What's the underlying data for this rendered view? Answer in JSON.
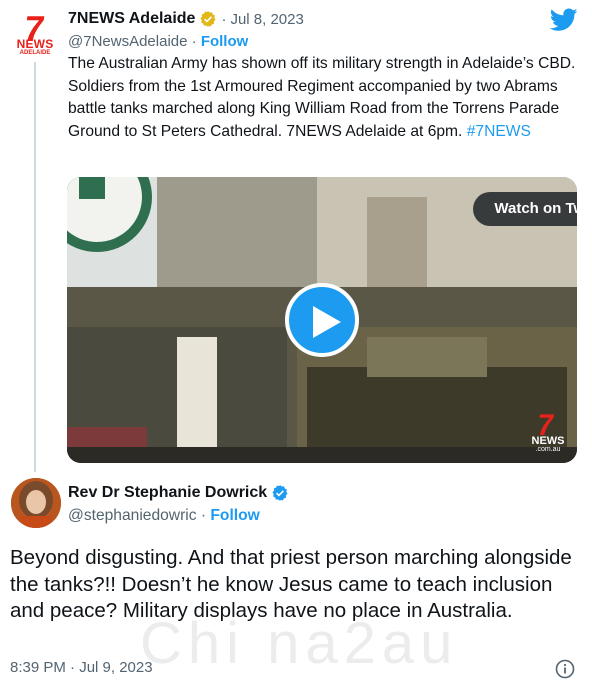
{
  "quoted_tweet": {
    "author_name": "7NEWS Adelaide",
    "date": "Jul 8, 2023",
    "dot": "·",
    "handle": "@7NewsAdelaide",
    "handle_sep": " · ",
    "follow_label": "Follow",
    "text": "The Australian Army has shown off its military strength in Adelaide’s CBD. Soldiers from the 1st Armoured Regiment accompanied by two Abrams battle tanks marched along King William Road from the Torrens Parade Ground to St Peters Cathedral. 7NEWS Adelaide at 6pm. ",
    "hashtag": "#7NEWS",
    "avatar_logo": {
      "seven": "7",
      "news": "NEWS",
      "sub": "ADELAIDE"
    },
    "media": {
      "watch_button_label": "Watch on Twitter",
      "play_icon": "play-icon",
      "logo": {
        "seven": "7",
        "news": "NEWS",
        "domain": ".com.au"
      }
    }
  },
  "main_tweet": {
    "author_name": "Rev Dr Stephanie Dowrick",
    "handle": "@stephaniedowric",
    "handle_sep": " · ",
    "follow_label": "Follow",
    "text": "Beyond disgusting. And that priest person marching alongside the tanks?!! Doesn’t he know Jesus came to teach inclusion and peace? Military displays have no place in Australia.",
    "timestamp": "8:39 PM · Jul 9, 2023"
  },
  "watermark": "Chi na2au",
  "icons": {
    "twitter": "twitter-bird-icon",
    "verified_gold": "verified-gold-icon",
    "verified_blue": "verified-blue-icon",
    "info": "info-icon"
  },
  "colors": {
    "accent": "#1d9bf0",
    "text": "#0f1419",
    "secondary": "#536471",
    "news_red": "#e8211b",
    "gold": "#e2b719"
  }
}
